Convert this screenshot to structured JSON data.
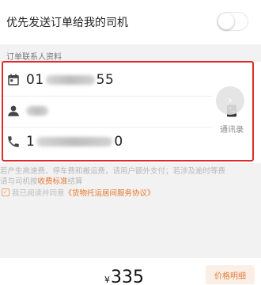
{
  "priority_dispatch": {
    "label": "优先发送订单给我的司机",
    "enabled": false
  },
  "contact_section": {
    "title": "订单联系人资料"
  },
  "contact_fields": [
    {
      "icon": "calendar-icon",
      "prefix": "01",
      "suffix": "55"
    },
    {
      "icon": "person-icon",
      "prefix": "",
      "suffix": ""
    },
    {
      "icon": "phone-icon",
      "prefix": "1",
      "suffix": "0"
    }
  ],
  "contacts_button": {
    "label": "通讯录",
    "icon": "contacts-book-icon"
  },
  "fee_notice": {
    "line1": "若产生高速费、停车费和搬运费，请用户额外支付；若涉及逾时等费",
    "line2_prefix": "请与司机按",
    "line2_link": "收费标准",
    "line2_suffix": "结算"
  },
  "agreement": {
    "prefix": "我已阅读并同意",
    "link": "《货物托运居间服务协议》",
    "checked": true
  },
  "footer": {
    "currency": "¥",
    "price": "335",
    "details_label": "价格明细"
  },
  "colors": {
    "accent": "#e8762c",
    "highlight_border": "#e02a2a"
  }
}
